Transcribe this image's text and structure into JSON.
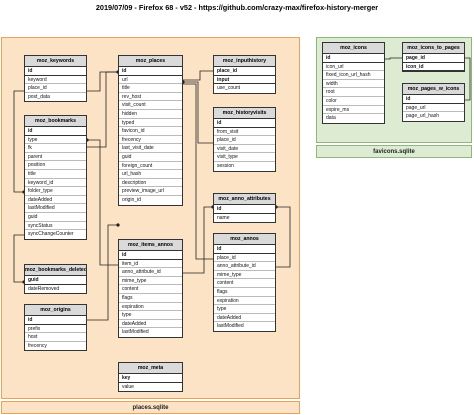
{
  "title": "2019/07/09 - Firefox 68 - v52 - https://github.com/crazy-max/firefox-history-merger",
  "colors": {
    "places_bg": "#fce3c5",
    "places_border": "#e8a35a",
    "favicons_bg": "#dcebd2",
    "favicons_border": "#8fb77a",
    "header_bg": "#dadada"
  },
  "places_db_label": "places.sqlite",
  "favicons_db_label": "favicons.sqlite",
  "tables": {
    "moz_keywords": {
      "name": "moz_keywords",
      "key": "id",
      "fields": [
        "keyword",
        "place_id",
        "post_data"
      ]
    },
    "moz_bookmarks": {
      "name": "moz_bookmarks",
      "key": "id",
      "fields": [
        "type",
        "fk",
        "parent",
        "position",
        "title",
        "keyword_id",
        "folder_type",
        "dateAdded",
        "lastModified",
        "guid",
        "syncStatus",
        "syncChangeCounter"
      ]
    },
    "moz_bookmarks_deleted": {
      "name": "moz_bookmarks_deleted",
      "key": "guid",
      "fields": [
        "dateRemoved"
      ]
    },
    "moz_origins": {
      "name": "moz_origins",
      "key": "id",
      "fields": [
        "prefix",
        "host",
        "frecency"
      ]
    },
    "moz_places": {
      "name": "moz_places",
      "key": "id",
      "fields": [
        "url",
        "title",
        "rev_host",
        "visit_count",
        "hidden",
        "typed",
        "favicon_id",
        "frecency",
        "last_visit_date",
        "guid",
        "foreign_count",
        "url_hash",
        "description",
        "preview_image_url",
        "origin_id"
      ]
    },
    "moz_inputhistory": {
      "name": "moz_inputhistory",
      "key": "place_id",
      "fields": [
        "input",
        "use_count"
      ],
      "bold_fields": [
        "input"
      ]
    },
    "moz_historyvisits": {
      "name": "moz_historyvisits",
      "key": "id",
      "fields": [
        "from_visit",
        "place_id",
        "visit_date",
        "visit_type",
        "session"
      ]
    },
    "moz_anno_attributes": {
      "name": "moz_anno_attributes",
      "key": "id",
      "fields": [
        "name"
      ]
    },
    "moz_annos": {
      "name": "moz_annos",
      "key": "id",
      "fields": [
        "place_id",
        "anno_attribute_id",
        "mime_type",
        "content",
        "flags",
        "expiration",
        "type",
        "dateAdded",
        "lastModified"
      ]
    },
    "moz_items_annos": {
      "name": "moz_items_annos",
      "key": "id",
      "fields": [
        "item_id",
        "anno_attribute_id",
        "mime_type",
        "content",
        "flags",
        "expiration",
        "type",
        "dateAdded",
        "lastModified"
      ]
    },
    "moz_meta": {
      "name": "moz_meta",
      "key": "key",
      "fields": [
        "value"
      ]
    },
    "moz_icons": {
      "name": "moz_icons",
      "key": "id",
      "fields": [
        "icon_url",
        "fixed_icon_url_hash",
        "width",
        "root",
        "color",
        "expire_ms",
        "data"
      ]
    },
    "moz_icons_to_pages": {
      "name": "moz_icons_to_pages",
      "key": "page_id",
      "fields": [
        "icon_id"
      ],
      "bold_fields": [
        "icon_id"
      ]
    },
    "moz_pages_w_icons": {
      "name": "moz_pages_w_icons",
      "key": "id",
      "fields": [
        "page_url",
        "page_url_hash"
      ]
    }
  }
}
